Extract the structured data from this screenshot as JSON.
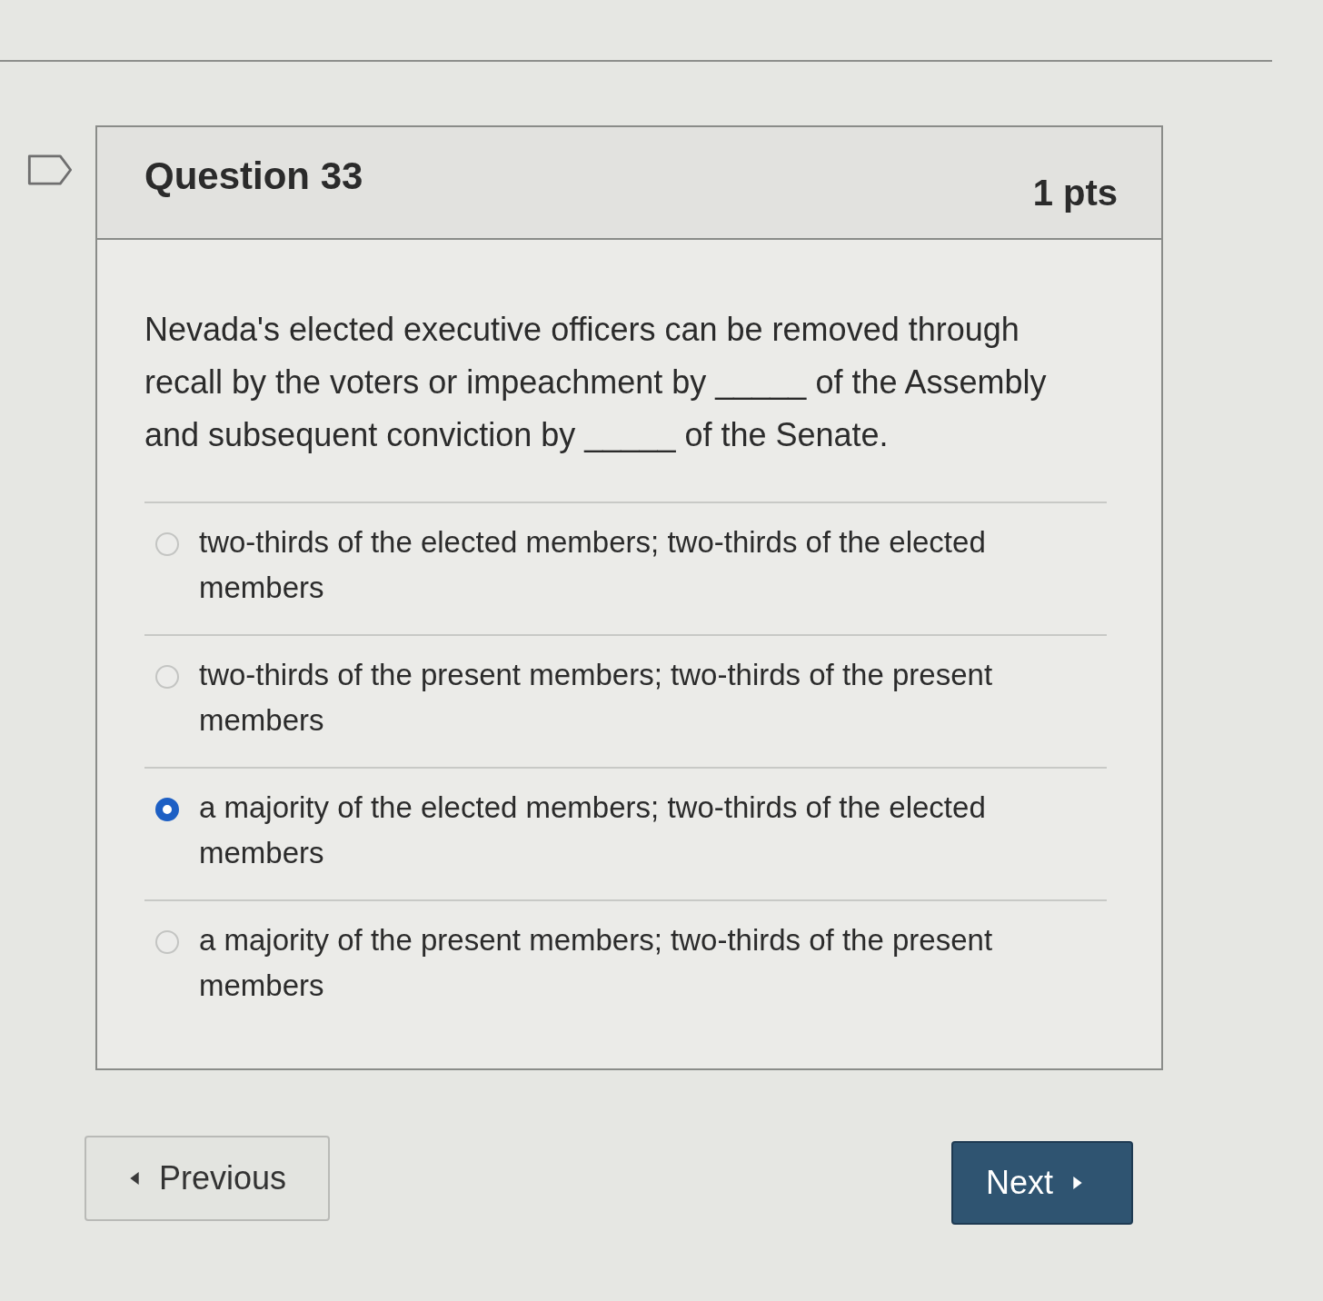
{
  "question": {
    "title": "Question 33",
    "points": "1 pts",
    "text": "Nevada's elected executive officers can be removed through recall by the voters or impeachment by _____ of the Assembly and subsequent conviction by _____ of the Senate."
  },
  "answers": [
    {
      "label": "two-thirds of the elected members; two-thirds of the elected members",
      "selected": false
    },
    {
      "label": "two-thirds of the present members; two-thirds of the present members",
      "selected": false
    },
    {
      "label": "a majority of the elected members; two-thirds of the elected members",
      "selected": true
    },
    {
      "label": "a majority of the present members; two-thirds of the present members",
      "selected": false
    }
  ],
  "navigation": {
    "previous": "Previous",
    "next": "Next"
  }
}
